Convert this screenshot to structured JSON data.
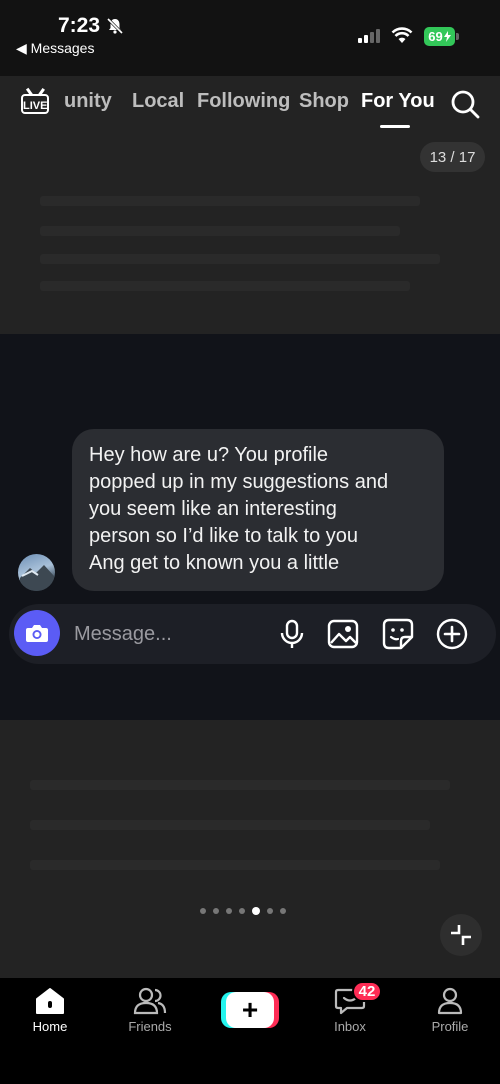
{
  "status_bar": {
    "time": "7:23",
    "back_label": "◀ Messages",
    "battery": "69"
  },
  "top_nav": {
    "tabs": [
      {
        "label": "unity"
      },
      {
        "label": "Local"
      },
      {
        "label": "Following"
      },
      {
        "label": "Shop"
      },
      {
        "label": "For You",
        "active": true
      }
    ],
    "live_label": "LIVE",
    "counter": "13 / 17"
  },
  "chat": {
    "message_lines": [
      "Hey how are u? You profile",
      "popped up in my suggestions and",
      "you seem like an interesting",
      "person so I’d like to talk to you",
      "Ang get to known you a little"
    ],
    "input_placeholder": "Message..."
  },
  "pagination": {
    "total": 7,
    "active_index": 4
  },
  "tabbar": {
    "items": [
      {
        "label": "Home",
        "icon": "home-icon",
        "active": true
      },
      {
        "label": "Friends",
        "icon": "friends-icon"
      },
      {
        "label": "",
        "icon": "plus-icon"
      },
      {
        "label": "Inbox",
        "icon": "inbox-icon"
      },
      {
        "label": "Profile",
        "icon": "profile-icon"
      }
    ],
    "inbox_badge": "42"
  },
  "colors": {
    "accent_camera": "#5b5cf5",
    "badge": "#fe2c55",
    "battery": "#33c759",
    "tiktok_cyan": "#25f4ee"
  }
}
